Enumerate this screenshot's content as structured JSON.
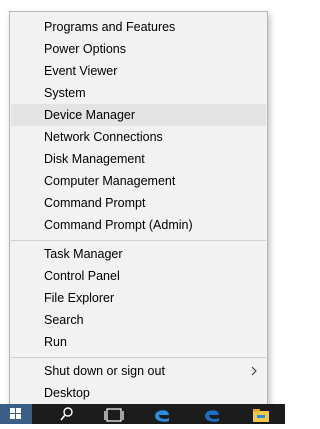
{
  "menu": {
    "items": [
      {
        "label": "Programs and Features"
      },
      {
        "label": "Power Options"
      },
      {
        "label": "Event Viewer"
      },
      {
        "label": "System"
      },
      {
        "label": "Device Manager"
      },
      {
        "label": "Network Connections"
      },
      {
        "label": "Disk Management"
      },
      {
        "label": "Computer Management"
      },
      {
        "label": "Command Prompt"
      },
      {
        "label": "Command Prompt (Admin)"
      },
      {
        "label": "Task Manager"
      },
      {
        "label": "Control Panel"
      },
      {
        "label": "File Explorer"
      },
      {
        "label": "Search"
      },
      {
        "label": "Run"
      },
      {
        "label": "Shut down or sign out"
      },
      {
        "label": "Desktop"
      }
    ],
    "highlighted_index": 4
  },
  "taskbar": {
    "buttons": [
      "windows-start-icon",
      "search-icon",
      "task-view-icon",
      "edge-icon",
      "edge-icon",
      "file-explorer-icon"
    ],
    "accent": "#3a5e86"
  }
}
